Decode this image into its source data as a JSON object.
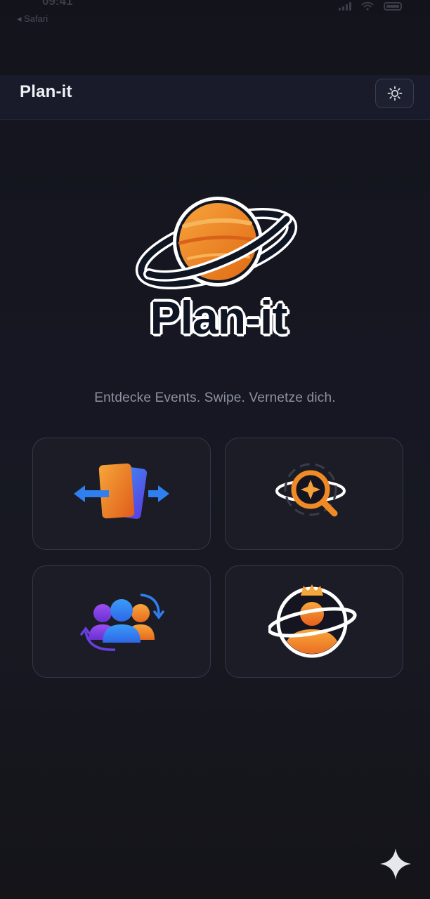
{
  "status_bar": {
    "time": "09:41",
    "back_label": "◂ Safari"
  },
  "app_bar": {
    "title": "Plan-it",
    "theme_icon": "sun-icon"
  },
  "logo": {
    "text": "Plan-it",
    "icon": "planet-icon",
    "colors": {
      "planet": "#f08a24",
      "ring": "#0f1522",
      "outline": "#ffffff"
    }
  },
  "tagline": "Entdecke Events. Swipe. Vernetze dich.",
  "tiles": [
    {
      "icon": "swipe-cards-icon"
    },
    {
      "icon": "discover-search-icon"
    },
    {
      "icon": "community-icon"
    },
    {
      "icon": "profile-crown-icon"
    }
  ],
  "fab_icon": "sparkle-icon",
  "colors": {
    "background": "#14151d",
    "app_bar": "#191b2a",
    "tile_bg": "#1b1c26",
    "tile_border": "#34374a",
    "accent_orange": "#f08a24",
    "accent_blue": "#2f7ff0",
    "accent_purple": "#7b3fe0"
  }
}
